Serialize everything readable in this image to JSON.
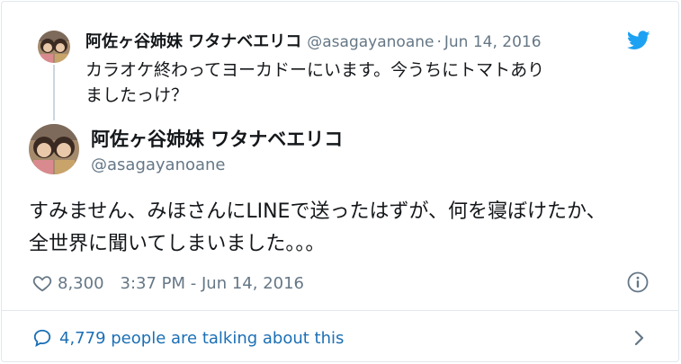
{
  "parent_tweet": {
    "name": "阿佐ヶ谷姉妹 ワタナベエリコ",
    "handle": "@asagayanoane",
    "separator": "·",
    "date": "Jun 14, 2016",
    "text": "カラオケ終わってヨーカドーにいます。今うちにトマトありましたっけ？"
  },
  "main_tweet": {
    "name": "阿佐ヶ谷姉妹 ワタナベエリコ",
    "handle": "@asagayanoane",
    "text": "すみません、みほさんにLINEで送ったはずが、何を寝ぼけたか、全世界に聞いてしまいました。。。"
  },
  "meta": {
    "like_count": "8,300",
    "timestamp": "3:37 PM - Jun 14, 2016"
  },
  "footer": {
    "talking_text": "4,779 people are talking about this"
  },
  "icons": {
    "twitter": "twitter-bird-icon",
    "heart": "heart-icon",
    "info": "info-icon",
    "bubble": "speech-bubble-icon",
    "chevron": "chevron-right-icon"
  },
  "colors": {
    "twitter_blue": "#1da1f2",
    "link_blue": "#1b6fb5",
    "secondary_text": "#657786",
    "border": "#e1e8ed"
  }
}
